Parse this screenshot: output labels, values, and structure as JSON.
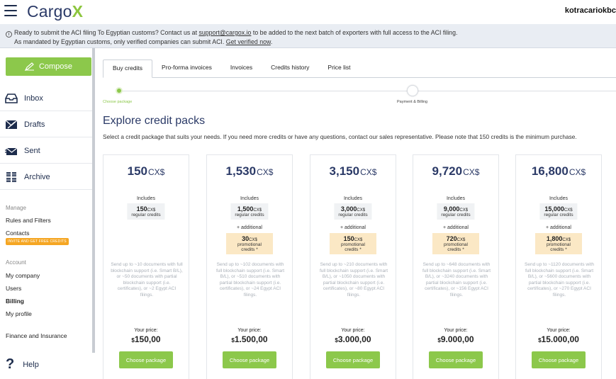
{
  "header": {
    "logo_text": "Cargo",
    "logo_accent": "X",
    "username": "kotracariokbc"
  },
  "notice": {
    "line1_prefix": "Ready to submit the ACI filing To Egyptian customs? Contact us at",
    "email": "support@cargox.io",
    "line1_suffix": "to be added to the next batch of exporters with full access to the ACI filing.",
    "line2_prefix": "As mandated by Egyptian customs, only verified companies can submit ACI.",
    "verify_link": "Get verified now"
  },
  "sidebar": {
    "compose_label": "Compose",
    "nav": [
      {
        "label": "Inbox",
        "icon": "inbox-icon"
      },
      {
        "label": "Drafts",
        "icon": "drafts-icon"
      },
      {
        "label": "Sent",
        "icon": "sent-icon"
      },
      {
        "label": "Archive",
        "icon": "archive-icon"
      }
    ],
    "manage_label": "Manage",
    "rules_label": "Rules and Filters",
    "contacts_label": "Contacts",
    "invite_badge": "INVITE AND GET FREE CREDITS",
    "account_label": "Account",
    "my_company": "My company",
    "users": "Users",
    "billing": "Billing",
    "my_profile": "My profile",
    "finance": "Finance and Insurance",
    "help": "Help"
  },
  "tabs": [
    "Buy credits",
    "Pro-forma invoices",
    "Invoices",
    "Credits history",
    "Price list"
  ],
  "stepper": {
    "step1": "Choose package",
    "step2": "Payment & Billing"
  },
  "main": {
    "title": "Explore credit packs",
    "description": "Select a credit package that suits your needs. If you need more credits or have any questions, contact our sales representative. Please note that 150 credits is the minimum purchase."
  },
  "pack_common": {
    "unit": "CX$",
    "includes": "Includes",
    "regular_label": "regular credits",
    "additional": "+ additional",
    "promo_label": "promotional credits *",
    "price_label": "Your price:",
    "choose_label": "Choose package",
    "currency": "$"
  },
  "packs": [
    {
      "amount": "150",
      "regular": "150",
      "promo": "",
      "price": "150,00",
      "desc": "Send up to ~10 documents with full blockchain support (i.e. Smart B/L), or ~50 documents with partial blockchain support (i.e. certificates), or ~2 Egypt ACI filings."
    },
    {
      "amount": "1,530",
      "regular": "1,500",
      "promo": "30",
      "price": "1.500,00",
      "desc": "Send up to ~102 documents with full blockchain support (i.e. Smart B/L), or ~510 documents with partial blockchain support (i.e. certificates), or ~24 Egypt ACI filings."
    },
    {
      "amount": "3,150",
      "regular": "3,000",
      "promo": "150",
      "price": "3.000,00",
      "desc": "Send up to ~210 documents with full blockchain support (i.e. Smart B/L), or ~1050 documents with partial blockchain support (i.e. certificates), or ~80 Egypt ACI filings."
    },
    {
      "amount": "9,720",
      "regular": "9,000",
      "promo": "720",
      "price": "9.000,00",
      "desc": "Send up to ~648 documents with full blockchain support (i.e. Smart B/L), or ~3240 documents with partial blockchain support (i.e. certificates), or ~156 Egypt ACI filings."
    },
    {
      "amount": "16,800",
      "regular": "15,000",
      "promo": "1,800",
      "price": "15.000,00",
      "desc": "Send up to ~1120 documents with full blockchain support (i.e. Smart B/L), or ~5600 documents with partial blockchain support (i.e. certificates), or ~270 Egypt ACI filings."
    }
  ],
  "colors": {
    "brand_navy": "#2b3a67",
    "brand_green": "#8cc84b",
    "promo_bg": "#fbe8c5",
    "badge_orange": "#f5a623"
  }
}
